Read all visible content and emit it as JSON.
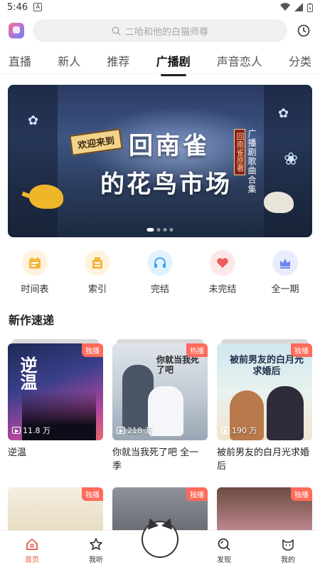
{
  "status_bar": {
    "time": "5:46",
    "notice_glyph": "A"
  },
  "search": {
    "placeholder": "二哈和他的白猫师尊"
  },
  "tabs": [
    {
      "label": "直播"
    },
    {
      "label": "新人"
    },
    {
      "label": "推荐"
    },
    {
      "label": "广播剧",
      "active": true
    },
    {
      "label": "声音恋人"
    },
    {
      "label": "分类"
    }
  ],
  "banner": {
    "welcome": "欢迎来到",
    "title_line1": "回南雀",
    "title_line2": "的花鸟市场",
    "seal": "回南雀原著",
    "subtitle": "广播剧歌曲合集",
    "dot_count": 4,
    "active_dot": 0
  },
  "categories": [
    {
      "label": "时间表",
      "icon": "calendar-icon",
      "color": "#f5b53d",
      "bg": "#fff3dd"
    },
    {
      "label": "索引",
      "icon": "index-icon",
      "color": "#f5b53d",
      "bg": "#fff3dd"
    },
    {
      "label": "完结",
      "icon": "headphones-icon",
      "color": "#3aa7f0",
      "bg": "#e3f3fd"
    },
    {
      "label": "未完结",
      "icon": "heart-icon",
      "color": "#ef5b5b",
      "bg": "#fde8e8"
    },
    {
      "label": "全一期",
      "icon": "crown-icon",
      "color": "#6b86f2",
      "bg": "#e8ecfd"
    }
  ],
  "section": {
    "title": "新作速递"
  },
  "cards": [
    {
      "title": "逆温",
      "plays": "11.8 万",
      "badge": "独播",
      "cover_text": "逆温"
    },
    {
      "title": "你就当我死了吧 全一季",
      "plays": "218 万",
      "badge": "热播",
      "cover_text": "你就当我死了吧"
    },
    {
      "title": "被前男友的白月光求婚后",
      "plays": "190 万",
      "badge": "独播",
      "cover_text": "被前男友的白月光求婚后"
    }
  ],
  "cards_row2": [
    {
      "badge": "独播"
    },
    {
      "badge": "独播"
    },
    {
      "badge": "独播"
    }
  ],
  "bottom_nav": [
    {
      "label": "首页",
      "icon": "home-icon",
      "active": true
    },
    {
      "label": "我听",
      "icon": "star-icon"
    },
    {
      "label": "",
      "icon": "cat-icon"
    },
    {
      "label": "发现",
      "icon": "discover-icon"
    },
    {
      "label": "我的",
      "icon": "profile-icon"
    }
  ],
  "colors": {
    "accent": "#e8584d",
    "badge": "#ff6a5a"
  }
}
